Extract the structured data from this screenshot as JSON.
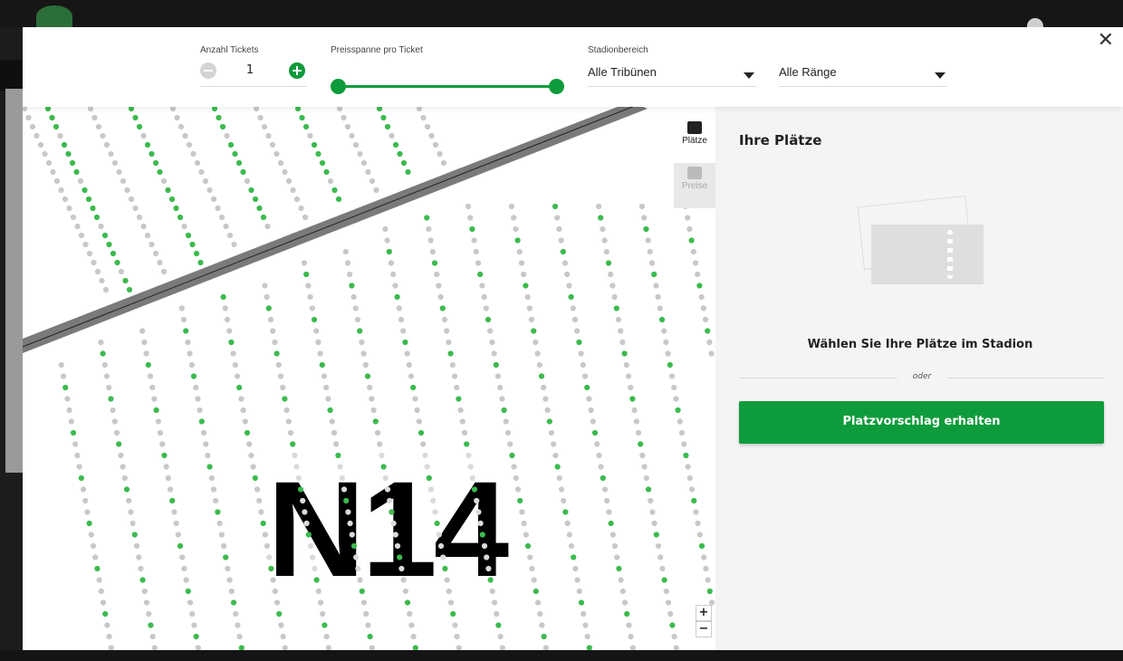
{
  "filters": {
    "tickets": {
      "label": "Anzahl Tickets",
      "value": "1"
    },
    "price": {
      "label": "Preisspanne pro Ticket"
    },
    "area": {
      "label": "Stadionbereich",
      "tribune": "Alle Tribünen",
      "rank": "Alle Ränge"
    }
  },
  "map": {
    "block_label": "N14",
    "tabs": [
      {
        "label": "Plätze",
        "active": true
      },
      {
        "label": "Preise",
        "active": false
      }
    ],
    "zoom_in": "+",
    "zoom_out": "−"
  },
  "panel": {
    "title": "Ihre Plätze",
    "choose_text": "Wählen Sie Ihre Plätze im Stadion",
    "or_text": "oder",
    "suggest_button": "Platzvorschlag erhalten"
  },
  "colors": {
    "accent": "#0e9b3b",
    "seat_available": "#3cba4e",
    "seat_unavailable": "#c8c8c8"
  }
}
